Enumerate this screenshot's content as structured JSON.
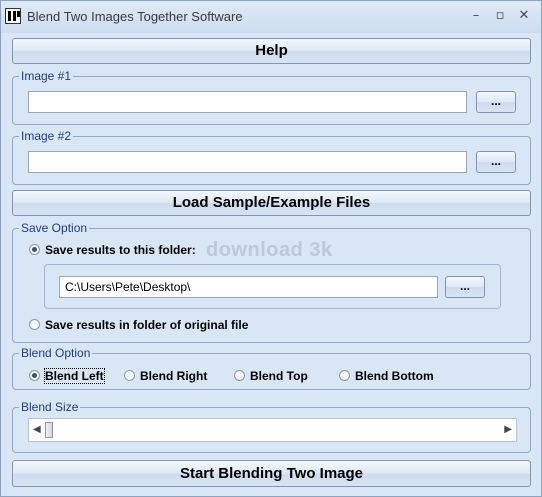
{
  "window": {
    "title": "Blend Two Images Together Software"
  },
  "buttons": {
    "help": "Help",
    "load_samples": "Load Sample/Example Files",
    "start": "Start Blending Two Image",
    "browse": "..."
  },
  "image1": {
    "legend": "Image #1",
    "value": ""
  },
  "image2": {
    "legend": "Image #2",
    "value": ""
  },
  "save_option": {
    "legend": "Save Option",
    "option_folder": "Save results to this folder:",
    "folder_path": "C:\\Users\\Pete\\Desktop\\",
    "option_original": "Save results in folder of original file",
    "selected": "folder"
  },
  "watermark": "download 3k",
  "blend_option": {
    "legend": "Blend Option",
    "options": [
      "Blend Left",
      "Blend Right",
      "Blend Top",
      "Blend Bottom"
    ],
    "selected": "Blend Left"
  },
  "blend_size": {
    "legend": "Blend Size",
    "level": 0
  }
}
